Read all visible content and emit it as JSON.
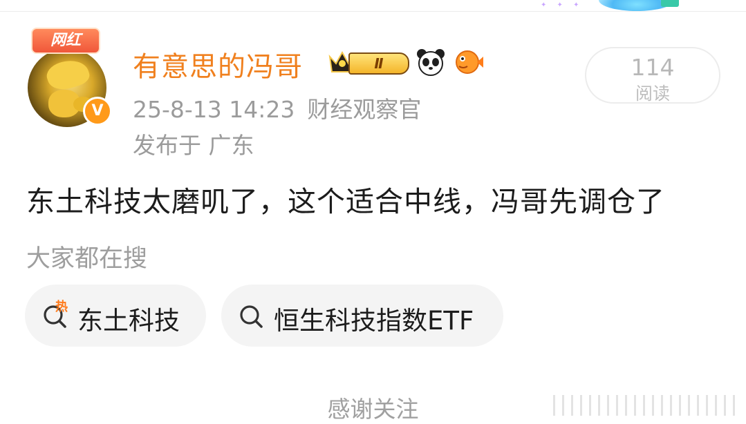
{
  "header": {
    "badge_label": "网红",
    "username": "有意思的冯哥",
    "level_badge": "Ⅱ",
    "timestamp": "25-8-13 14:23",
    "title_tag": "财经观察官",
    "location": "发布于 广东",
    "read_count": "114",
    "read_label": "阅读"
  },
  "post": {
    "text": "东土科技太磨叽了，这个适合中线，冯哥先调仓了"
  },
  "search_section": {
    "title": "大家都在搜",
    "hot_mark": "热",
    "chips": [
      {
        "label": "东土科技",
        "icon": "hot-search-icon"
      },
      {
        "label": "恒生科技指数ETF",
        "icon": "search-icon"
      }
    ]
  },
  "footer": {
    "text": "感谢关注"
  },
  "colors": {
    "username": "#f0801e",
    "meta": "#9b9b9b",
    "chip_bg": "#f4f4f4",
    "verified": "#ff9a19",
    "hot": "#ff7a1a"
  }
}
